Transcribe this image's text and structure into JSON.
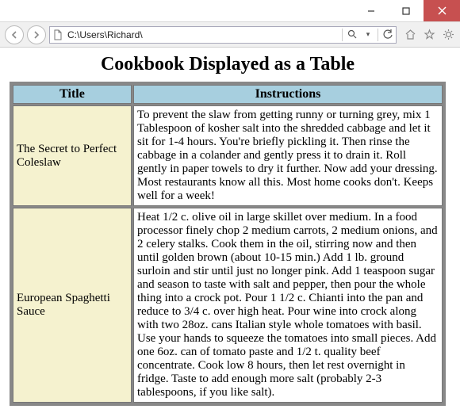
{
  "window": {
    "address": "C:\\Users\\Richard\\",
    "search_placeholder": ""
  },
  "page": {
    "heading": "Cookbook Displayed as a Table",
    "columns": {
      "title": "Title",
      "instructions": "Instructions"
    },
    "recipes": [
      {
        "title": "The Secret to Perfect Coleslaw",
        "instructions": "To prevent the slaw from getting runny or turning grey, mix 1 Tablespoon of kosher salt into the shredded cabbage and let it sit for 1-4 hours. You're briefly pickling it. Then rinse the cabbage in a colander and gently press it to drain it. Roll gently in paper towels to dry it further. Now add your dressing. Most restaurants know all this. Most home cooks don't. Keeps well for a week!"
      },
      {
        "title": "European Spaghetti Sauce",
        "instructions": "Heat 1/2 c. olive oil in large skillet over medium. In a food processor finely chop 2 medium carrots, 2 medium onions, and 2 celery stalks. Cook them in the oil, stirring now and then until golden brown (about 10-15 min.) Add 1 lb. ground surloin and stir until just no longer pink. Add 1 teaspoon sugar and season to taste with salt and pepper, then pour the whole thing into a crock pot. Pour 1 1/2 c. Chianti into the pan and reduce to 3/4 c. over high heat. Pour wine into crock along with two 28oz. cans Italian style whole tomatoes with basil. Use your hands to squeeze the tomatoes into small pieces. Add one 6oz. can of tomato paste and 1/2 t. quality beef concentrate. Cook low 8 hours, then let rest overnight in fridge. Taste to add enough more salt (probably 2-3 tablespoons, if you like salt)."
      }
    ]
  }
}
